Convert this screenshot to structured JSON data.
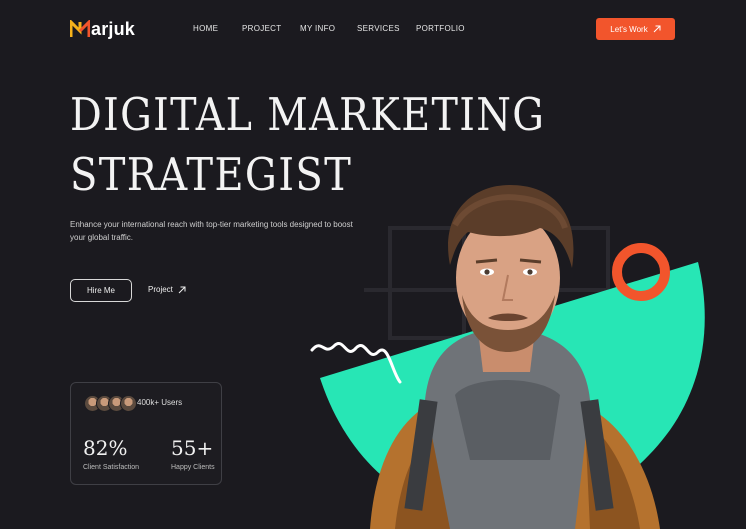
{
  "brand": {
    "name": "arjuk",
    "colors": {
      "accent": "#f2552c",
      "mint": "#27e6b5",
      "background": "#1b1a1f",
      "logo_yellow": "#f6b21b"
    }
  },
  "nav": {
    "items": [
      "HOME",
      "PROJECT",
      "MY INFO",
      "SERVICES",
      "PORTFOLIO"
    ],
    "cta_label": "Let's Work",
    "cta_icon": "arrow-up-right-icon"
  },
  "hero": {
    "headline_line1": "DIGITAL MARKETING",
    "headline_line2": "STRATEGIST",
    "description": "Enhance your international reach with top-tier marketing tools designed to boost your global traffic.",
    "primary_button": "Hire Me",
    "secondary_link": "Project",
    "secondary_icon": "arrow-up-right-icon"
  },
  "stats": {
    "users_label": "400k+ Users",
    "items": [
      {
        "value": "82%",
        "label": "Client Satisfaction"
      },
      {
        "value": "55+",
        "label": "Happy Clients"
      }
    ]
  },
  "decor": {
    "icons": [
      "close-x-icon",
      "orange-ring-shape",
      "squiggle-shape"
    ]
  }
}
